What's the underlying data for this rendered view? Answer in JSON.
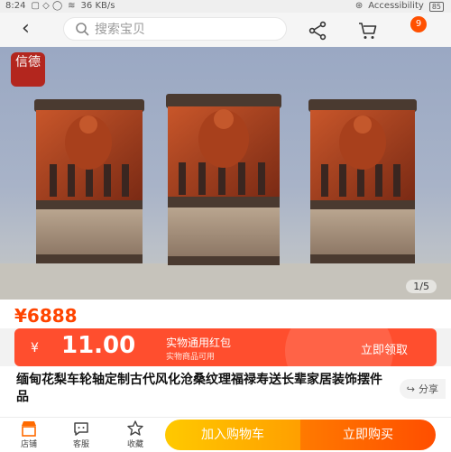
{
  "status_bar": {
    "time": "8:24",
    "network_speed": "36 KB/s",
    "accessibility": "Accessibility",
    "battery": "85"
  },
  "nav": {
    "back_icon": "chevron-left-icon",
    "search_placeholder": "搜索宝贝",
    "share_icon": "share-icon",
    "cart_icon": "cart-icon",
    "notification_count": "9"
  },
  "gallery": {
    "seal_text": "信德",
    "counter": "1/5"
  },
  "price": {
    "value": "¥6888",
    "color": "#ff4400"
  },
  "coupon": {
    "symbol": "¥",
    "amount": "11.00",
    "title": "实物通用红包",
    "subtitle": "实物商品可用",
    "claim_label": "立即领取",
    "color": "#ff4e2e"
  },
  "product": {
    "title": "缅甸花梨车轮轴定制古代风化沧桑纹理福禄寿送长辈家居装饰摆件品",
    "share_label": "分享"
  },
  "bottom_bar": {
    "tabs": [
      {
        "label": "店铺",
        "icon": "store-icon"
      },
      {
        "label": "客服",
        "icon": "chat-icon"
      },
      {
        "label": "收藏",
        "icon": "star-icon"
      }
    ],
    "add_to_cart": "加入购物车",
    "buy_now": "立即购买",
    "cart_color": "#ffb300",
    "buy_color": "#ff5a00"
  }
}
